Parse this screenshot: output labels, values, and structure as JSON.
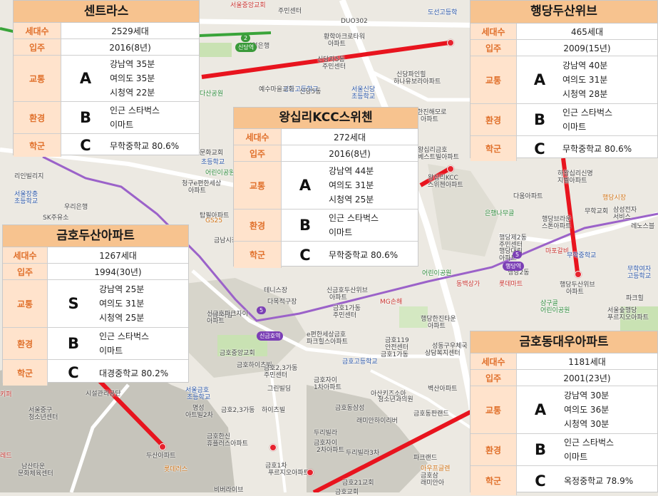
{
  "map": {
    "labels": [
      {
        "text": "서울중앙교회",
        "cls": "red"
      },
      {
        "text": "주민센터",
        "cls": ""
      },
      {
        "text": "DUO302",
        "cls": ""
      },
      {
        "text": "도선고등학",
        "cls": "blue"
      },
      {
        "text": "황학아크로타워",
        "cls": ""
      },
      {
        "text": "아파트",
        "cls": ""
      },
      {
        "text": "기업은행",
        "cls": ""
      },
      {
        "text": "신당자5동",
        "cls": ""
      },
      {
        "text": "주민센터",
        "cls": ""
      },
      {
        "text": "신당파인힐",
        "cls": ""
      },
      {
        "text": "하나유보라아파트",
        "cls": ""
      },
      {
        "text": "성동고등학교",
        "cls": "blue"
      },
      {
        "text": "서울신당",
        "cls": "blue"
      },
      {
        "text": "초등학교",
        "cls": "blue"
      },
      {
        "text": "다산공원",
        "cls": "green"
      },
      {
        "text": "예수마을교회",
        "cls": ""
      },
      {
        "text": "신당5동",
        "cls": ""
      },
      {
        "text": "한진해모로",
        "cls": ""
      },
      {
        "text": "아파트",
        "cls": ""
      },
      {
        "text": "왕십리금호",
        "cls": ""
      },
      {
        "text": "베스트빌아파트",
        "cls": ""
      },
      {
        "text": "문화교회",
        "cls": ""
      },
      {
        "text": "초등학교",
        "cls": "blue"
      },
      {
        "text": "리인빌리지",
        "cls": ""
      },
      {
        "text": "청구e편한세상",
        "cls": ""
      },
      {
        "text": "아파트",
        "cls": ""
      },
      {
        "text": "어린이공원",
        "cls": "green"
      },
      {
        "text": "서울장충",
        "cls": "blue"
      },
      {
        "text": "초등학교",
        "cls": "blue"
      },
      {
        "text": "우리은행",
        "cls": ""
      },
      {
        "text": "SK주유소",
        "cls": ""
      },
      {
        "text": "탑필아파트",
        "cls": ""
      },
      {
        "text": "GS25",
        "cls": "orange"
      },
      {
        "text": "금남시장",
        "cls": ""
      },
      {
        "text": "왕십리KCC",
        "cls": ""
      },
      {
        "text": "스위첸아파트",
        "cls": ""
      },
      {
        "text": "다움아파트",
        "cls": ""
      },
      {
        "text": "하왕십리신명",
        "cls": ""
      },
      {
        "text": "지벨아파트",
        "cls": ""
      },
      {
        "text": "행당시장",
        "cls": "orange"
      },
      {
        "text": "은행나무골",
        "cls": "green"
      },
      {
        "text": "무학교회",
        "cls": ""
      },
      {
        "text": "삼성전자",
        "cls": ""
      },
      {
        "text": "서비스",
        "cls": ""
      },
      {
        "text": "행당브라운",
        "cls": ""
      },
      {
        "text": "스톤아파트",
        "cls": ""
      },
      {
        "text": "레노스블",
        "cls": ""
      },
      {
        "text": "행당제2동",
        "cls": ""
      },
      {
        "text": "주민센터",
        "cls": ""
      },
      {
        "text": "마포갈비",
        "cls": "red"
      },
      {
        "text": "무학중학교",
        "cls": "blue"
      },
      {
        "text": "행당대림",
        "cls": ""
      },
      {
        "text": "아파트",
        "cls": ""
      },
      {
        "text": "행당2동",
        "cls": ""
      },
      {
        "text": "무학여자",
        "cls": "blue"
      },
      {
        "text": "고등학교",
        "cls": "blue"
      },
      {
        "text": "어린이공원",
        "cls": "green"
      },
      {
        "text": "동백상가",
        "cls": "red"
      },
      {
        "text": "롯데마트",
        "cls": "red"
      },
      {
        "text": "행당두산위브",
        "cls": ""
      },
      {
        "text": "아파트",
        "cls": ""
      },
      {
        "text": "파크힐",
        "cls": ""
      },
      {
        "text": "테니스장",
        "cls": ""
      },
      {
        "text": "신금호두산위브",
        "cls": ""
      },
      {
        "text": "아파트",
        "cls": ""
      },
      {
        "text": "다목적구장",
        "cls": ""
      },
      {
        "text": "금호1가동",
        "cls": ""
      },
      {
        "text": "주민센터",
        "cls": ""
      },
      {
        "text": "어린이집",
        "cls": ""
      },
      {
        "text": "MG손해",
        "cls": "red"
      },
      {
        "text": "행당한진타운",
        "cls": ""
      },
      {
        "text": "아파트",
        "cls": ""
      },
      {
        "text": "삼구골",
        "cls": "green"
      },
      {
        "text": "어린이공원",
        "cls": "green"
      },
      {
        "text": "서울숲행당",
        "cls": ""
      },
      {
        "text": "푸르지오아파트",
        "cls": ""
      },
      {
        "text": "신금호파크자이",
        "cls": ""
      },
      {
        "text": "아파트",
        "cls": ""
      },
      {
        "text": "e편한세상금호",
        "cls": ""
      },
      {
        "text": "파크힐스아파트",
        "cls": ""
      },
      {
        "text": "금호119",
        "cls": ""
      },
      {
        "text": "안전센터",
        "cls": ""
      },
      {
        "text": "금호1가동",
        "cls": ""
      },
      {
        "text": "성동구우체국",
        "cls": ""
      },
      {
        "text": "상담복지센터",
        "cls": ""
      },
      {
        "text": "금호중앙교회",
        "cls": ""
      },
      {
        "text": "금호하이츠빌",
        "cls": ""
      },
      {
        "text": "금호고등학교",
        "cls": "blue"
      },
      {
        "text": "금호2,3가동",
        "cls": ""
      },
      {
        "text": "주민센터",
        "cls": ""
      },
      {
        "text": "금호자이",
        "cls": ""
      },
      {
        "text": "1차아파트",
        "cls": ""
      },
      {
        "text": "벽산아파트",
        "cls": ""
      },
      {
        "text": "서울금호",
        "cls": "blue"
      },
      {
        "text": "초등학교",
        "cls": "blue"
      },
      {
        "text": "그린빌딩",
        "cls": ""
      },
      {
        "text": "시설관리공단",
        "cls": ""
      },
      {
        "text": "서울중구",
        "cls": ""
      },
      {
        "text": "청소년센터",
        "cls": ""
      },
      {
        "text": "아트빌2차",
        "cls": ""
      },
      {
        "text": "명성",
        "cls": ""
      },
      {
        "text": "금호2,3가동",
        "cls": ""
      },
      {
        "text": "하이츠빌",
        "cls": ""
      },
      {
        "text": "금호동삼성",
        "cls": ""
      },
      {
        "text": "아산키즈소아",
        "cls": ""
      },
      {
        "text": "청소년과의원",
        "cls": ""
      },
      {
        "text": "금호동판랜드",
        "cls": ""
      },
      {
        "text": "래미안하이리버",
        "cls": ""
      },
      {
        "text": "두리빌라",
        "cls": ""
      },
      {
        "text": "금호한신",
        "cls": ""
      },
      {
        "text": "휴플러스아파트",
        "cls": ""
      },
      {
        "text": "금호자이",
        "cls": ""
      },
      {
        "text": "2차아파트",
        "cls": ""
      },
      {
        "text": "두리빌라3차",
        "cls": ""
      },
      {
        "text": "파크랜드",
        "cls": ""
      },
      {
        "text": "두산아파트",
        "cls": ""
      },
      {
        "text": "금호1차",
        "cls": ""
      },
      {
        "text": "푸르지오아파트",
        "cls": ""
      },
      {
        "text": "아우프글렌",
        "cls": "orange"
      },
      {
        "text": "남산타운",
        "cls": ""
      },
      {
        "text": "문화체육센터",
        "cls": ""
      },
      {
        "text": "롯데러스",
        "cls": "orange"
      },
      {
        "text": "금호21교회",
        "cls": ""
      },
      {
        "text": "금호교회",
        "cls": ""
      },
      {
        "text": "금호삼",
        "cls": ""
      },
      {
        "text": "래미안아",
        "cls": ""
      },
      {
        "text": "비버라이브",
        "cls": ""
      },
      {
        "text": "레드",
        "cls": "red"
      },
      {
        "text": "키퍼",
        "cls": "red"
      }
    ],
    "badges": [
      {
        "text": "2",
        "cls": "green"
      },
      {
        "text": "신당역",
        "cls": "green"
      },
      {
        "text": "5",
        "cls": ""
      },
      {
        "text": "신금호역",
        "cls": ""
      },
      {
        "text": "5",
        "cls": ""
      },
      {
        "text": "행당역",
        "cls": ""
      }
    ]
  },
  "cards": [
    {
      "id": "centras",
      "title": "센트라스",
      "households_label": "세대수",
      "households": "2529세대",
      "movein_label": "입주",
      "movein": "2016(8년)",
      "transport_label": "교통",
      "transport_grade": "A",
      "transport": [
        "강남역 35분",
        "여의도 35분",
        "시청역 22분"
      ],
      "env_label": "환경",
      "env_grade": "B",
      "env": [
        "인근 스타벅스",
        "이마트"
      ],
      "school_label": "학군",
      "school_grade": "C",
      "school": "무학중학교 80.6%"
    },
    {
      "id": "haengdang",
      "title": "행당두산위브",
      "households_label": "세대수",
      "households": "465세대",
      "movein_label": "입주",
      "movein": "2009(15년)",
      "transport_label": "교통",
      "transport_grade": "A",
      "transport": [
        "강남역 40분",
        "여의도 31분",
        "시청역 28분"
      ],
      "env_label": "환경",
      "env_grade": "B",
      "env": [
        "인근 스타벅스",
        "이마트"
      ],
      "school_label": "학군",
      "school_grade": "C",
      "school": "무학중학교 80.6%"
    },
    {
      "id": "wangsimni",
      "title": "왕십리KCC스위첸",
      "households_label": "세대수",
      "households": "272세대",
      "movein_label": "입주",
      "movein": "2016(8년)",
      "transport_label": "교통",
      "transport_grade": "A",
      "transport": [
        "강남역 44분",
        "여의도 31분",
        "시청역 25분"
      ],
      "env_label": "환경",
      "env_grade": "B",
      "env": [
        "인근 스타벅스",
        "이마트"
      ],
      "school_label": "학군",
      "school_grade": "C",
      "school": "무학중학교 80.6%"
    },
    {
      "id": "geumho-doosan",
      "title": "금호두산아파트",
      "households_label": "세대수",
      "households": "1267세대",
      "movein_label": "입주",
      "movein": "1994(30년)",
      "transport_label": "교통",
      "transport_grade": "S",
      "transport": [
        "강남역 25분",
        "여의도 31분",
        "시청역 25분"
      ],
      "env_label": "환경",
      "env_grade": "B",
      "env": [
        "인근 스타벅스",
        "이마트"
      ],
      "school_label": "학군",
      "school_grade": "C",
      "school": "대경중학교 80.2%"
    },
    {
      "id": "geumho-daewoo",
      "title": "금호동대우아파트",
      "households_label": "세대수",
      "households": "1181세대",
      "movein_label": "입주",
      "movein": "2001(23년)",
      "transport_label": "교통",
      "transport_grade": "A",
      "transport": [
        "강남역 30분",
        "여의도 36분",
        "시청역 30분"
      ],
      "env_label": "환경",
      "env_grade": "B",
      "env": [
        "인근 스타벅스",
        "이마트"
      ],
      "school_label": "학군",
      "school_grade": "C",
      "school": "옥정중학교 78.9%"
    }
  ]
}
